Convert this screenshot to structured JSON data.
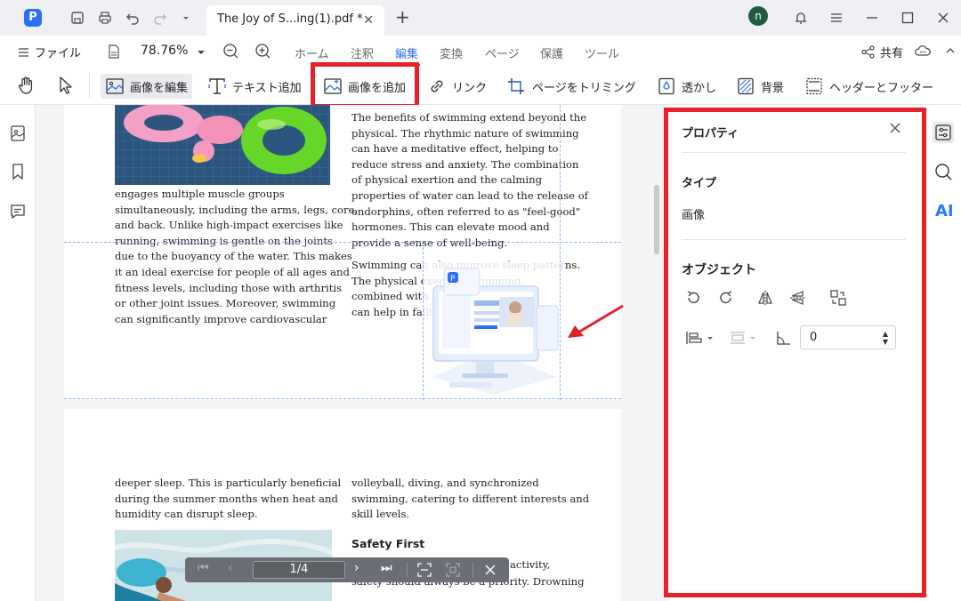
{
  "titlebar": {
    "tab_title": "The Joy of S...ing(1).pdf *",
    "tab_close": "✕",
    "new_tab": "+",
    "avatar_letter": "n",
    "app_letter": "P"
  },
  "menubar": {
    "file": "ファイル",
    "zoom": "78.76%",
    "tabs": [
      "ホーム",
      "注釈",
      "編集",
      "変換",
      "ページ",
      "保護",
      "ツール"
    ],
    "active_tab": "編集",
    "share": "共有"
  },
  "toolbar": {
    "edit_image": "画像を編集",
    "add_text": "テキスト追加",
    "add_image": "画像を追加",
    "link": "リンク",
    "trim_page": "ページをトリミング",
    "watermark": "透かし",
    "background": "背景",
    "header_footer": "ヘッダーとフッター"
  },
  "document": {
    "page1_left": [
      "engages multiple muscle groups",
      "simultaneously, including the arms, legs, core,",
      "and back. Unlike high-impact exercises like",
      "running, swimming is gentle on the joints",
      "due to the buoyancy of the water. This makes",
      "it an ideal exercise for people of all ages and",
      "fitness levels, including those with arthritis",
      "or other joint issues. Moreover, swimming",
      "can significantly improve cardiovascular"
    ],
    "page1_right": [
      "The benefits of swimming extend beyond the",
      "physical. The rhythmic nature of swimming",
      "can have a meditative effect, helping to",
      "reduce stress and anxiety. The combination",
      "of physical exertion and the calming",
      "properties of water can lead to the release of",
      "endorphins, often referred to as \"feel-good\"",
      "hormones. This can elevate mood and",
      "provide a sense of well-being."
    ],
    "page1_right2": [
      "Swimming can also improve sleep patterns.",
      "The physical exerti          in swimming,",
      "combined with the",
      "can help in falling"
    ],
    "page2_left": [
      "deeper sleep. This is particularly beneficial",
      "during the summer months when heat and",
      "humidity can disrupt sleep."
    ],
    "page2_right": [
      "volleyball, diving, and synchronized",
      "swimming, catering to different interests and",
      "skill levels."
    ],
    "safety_heading": "Safety First",
    "page2_right2": [
      "activity,",
      "safety should always be a priority. Drowning"
    ]
  },
  "pagenav": {
    "page": "1/4"
  },
  "properties": {
    "title": "プロパティ",
    "type_label": "タイプ",
    "type_value": "画像",
    "object_label": "オブジェクト",
    "rotation_value": "0"
  },
  "rightrail": {
    "ai": "AI"
  },
  "colors": {
    "accent": "#2b6ff5",
    "highlight": "#e8202a",
    "ai": "#2b7bf0"
  }
}
